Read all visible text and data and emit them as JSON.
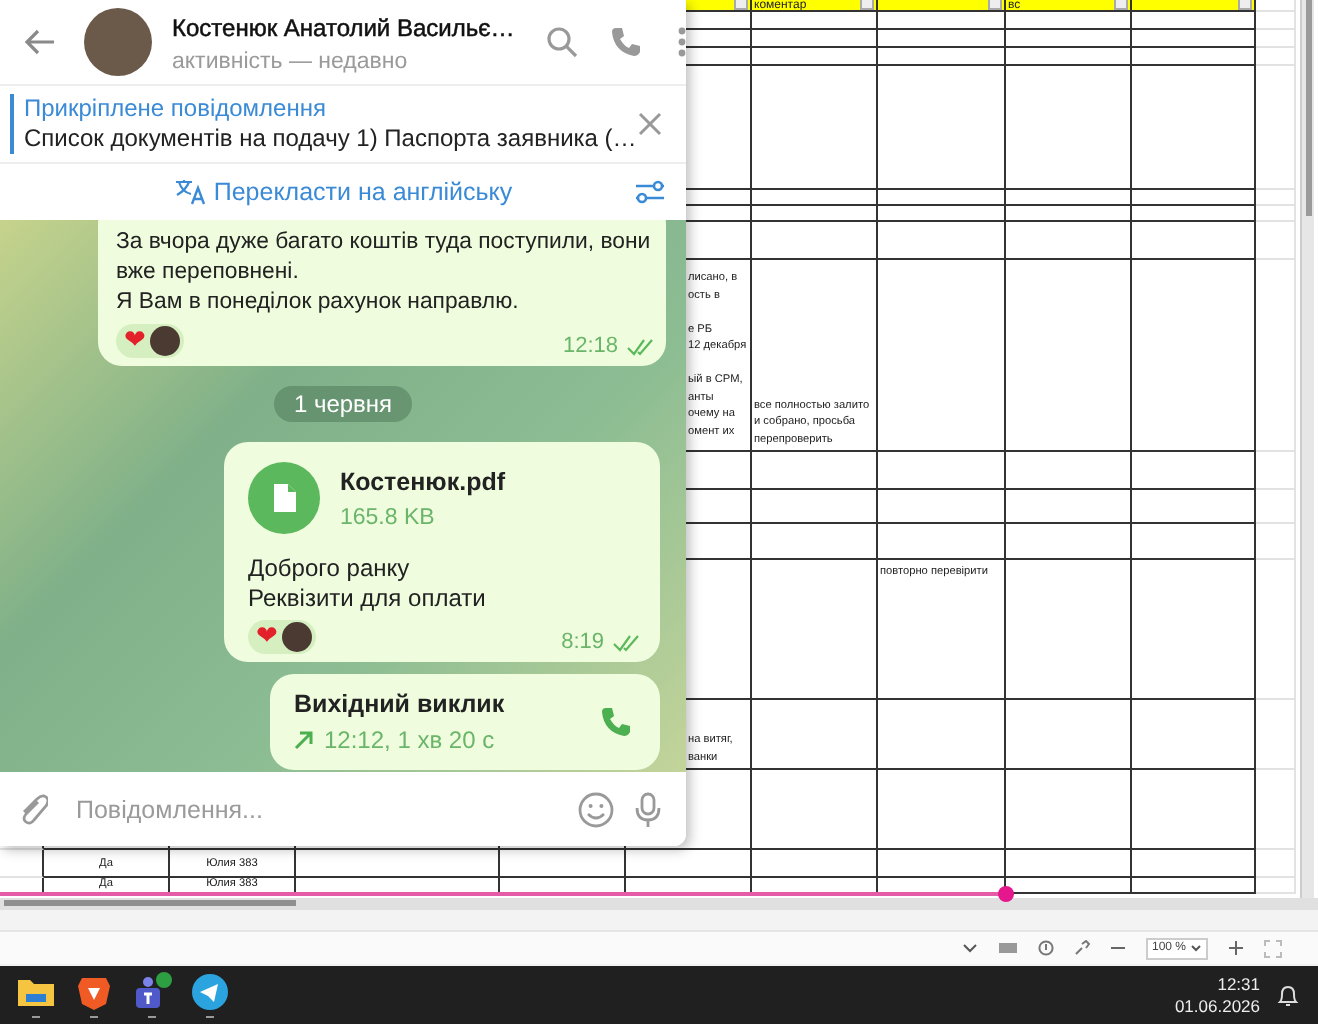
{
  "sheet": {
    "header": {
      "column_7": "коментар",
      "column_9": "вс"
    },
    "rows": [
      {},
      {},
      {},
      {},
      {},
      {},
      {},
      {
        "column_6": "лисано, в\nость в\n\nе РБ\n12 декабря\n\nьій в CPM,\nанты\nочему на\nомент их",
        "column_7": "все полностью залито\nи собрано, просьба\nперепроверить"
      },
      {},
      {},
      {},
      {
        "column_8": "повторно перевірити"
      },
      {
        "column_6": "на витяг,\nванки"
      },
      {},
      {
        "column_2": "Да",
        "column_3": "Юлия 383"
      },
      {
        "column_2": "Да",
        "column_3": "Юлия 383"
      }
    ],
    "zoom": "100 %"
  },
  "chat": {
    "title": "Костенюк Анатолий Васильє…",
    "status": "активність — недавно",
    "pinned": {
      "label": "Прикріплене повідомлення",
      "text": "Список документів на подачу  1) Паспорта заявника (…"
    },
    "translate": {
      "label": "Перекласти на англійську"
    },
    "messages": [
      {
        "kind": "text",
        "text": "За вчора дуже багато коштів туда поступили, вони\nвже переповнені.\nЯ Вам в понеділок рахунок направлю.",
        "reactions": [
          {
            "emoji": "❤"
          }
        ],
        "time": "12:18",
        "read": true
      },
      {
        "kind": "date",
        "text": "1 червня"
      },
      {
        "kind": "file",
        "file_name": "Костенюк.pdf",
        "file_size": "165.8 KB",
        "text": "Доброго ранку\nРеквізити для оплати",
        "reactions": [
          {
            "emoji": "❤"
          }
        ],
        "time": "8:19",
        "read": true
      },
      {
        "kind": "call",
        "title": "Вихідний виклик",
        "detail": "12:12, 1 хв 20 с"
      }
    ],
    "composer": {
      "placeholder": "Повідомлення..."
    }
  },
  "taskbar": {
    "apps": [
      {
        "kind": "folder",
        "running": true
      },
      {
        "kind": "brave",
        "running": true
      },
      {
        "kind": "teams",
        "running": true
      },
      {
        "kind": "telegram",
        "running": true
      }
    ],
    "time": "12:31",
    "date": "01.06.2026"
  }
}
